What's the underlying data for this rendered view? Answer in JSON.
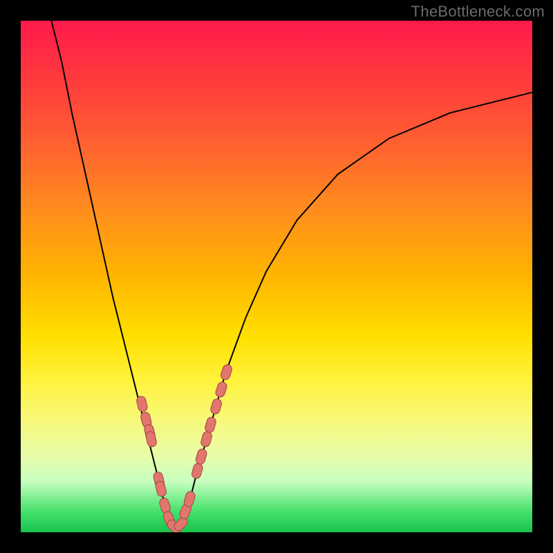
{
  "watermark": "TheBottleneck.com",
  "colors": {
    "background_frame": "#000000",
    "gradient_top": "#ff1a4d",
    "gradient_mid": "#ffe000",
    "gradient_bottom": "#17c24e",
    "curve": "#000000",
    "point_fill": "#e2766e",
    "point_stroke": "#a84f49"
  },
  "chart_data": {
    "type": "line",
    "title": "",
    "xlabel": "",
    "ylabel": "",
    "xlim": [
      0,
      100
    ],
    "ylim": [
      0,
      100
    ],
    "grid": false,
    "legend": false,
    "series": [
      {
        "name": "bottleneck-curve",
        "x": [
          6,
          8,
          10,
          12,
          14,
          16,
          18,
          20,
          22,
          24,
          26,
          27,
          28,
          29,
          30,
          31,
          32,
          33,
          34,
          36,
          38,
          40,
          44,
          48,
          54,
          62,
          72,
          84,
          100
        ],
        "y": [
          100,
          92,
          82,
          73,
          64,
          55,
          46,
          38,
          30,
          22,
          14,
          10,
          6,
          3,
          1,
          1,
          3,
          6,
          10,
          17,
          24,
          31,
          42,
          51,
          61,
          70,
          77,
          82,
          86
        ]
      }
    ],
    "scatter_points": {
      "name": "highlighted-data",
      "x": [
        23.7,
        24.5,
        25.2,
        25.5,
        27.0,
        27.4,
        28.2,
        29.0,
        30.0,
        31.3,
        32.2,
        33.0,
        34.5,
        35.3,
        36.3,
        37.1,
        38.2,
        39.2,
        40.2
      ],
      "y": [
        25.1,
        22.0,
        19.6,
        18.2,
        10.3,
        8.5,
        5.2,
        2.6,
        1.1,
        1.6,
        4.1,
        6.5,
        12.0,
        14.8,
        18.2,
        21.0,
        24.6,
        27.9,
        31.3
      ]
    }
  }
}
